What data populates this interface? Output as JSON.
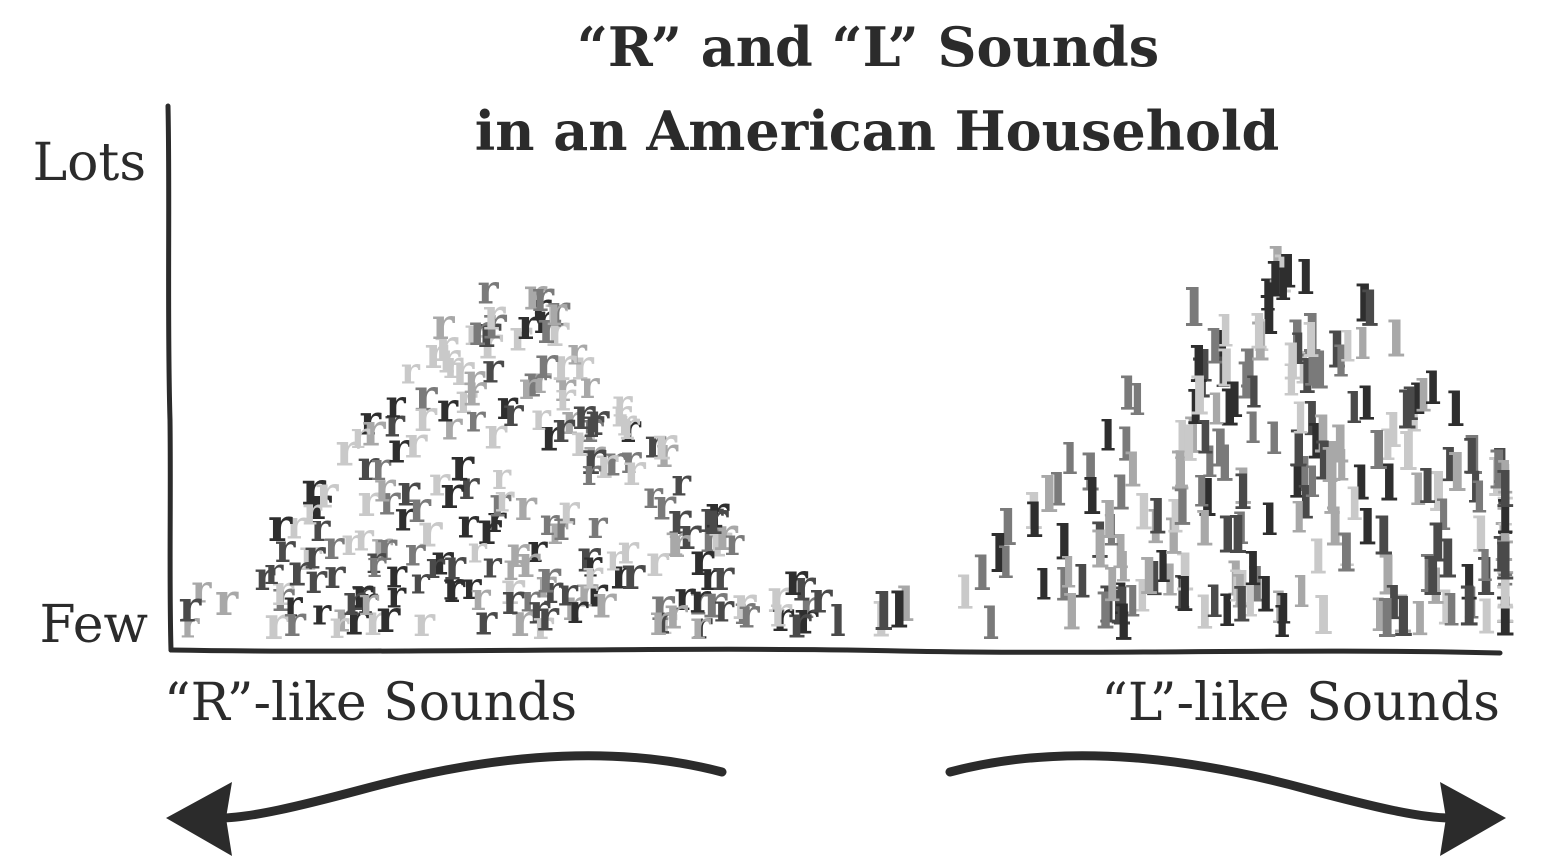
{
  "chart_data": {
    "type": "area",
    "title_line1": "“R” and “L” Sounds",
    "title_line2": "in an American Household",
    "y_top_label": "Lots",
    "y_bottom_label": "Few",
    "categories": [
      "“R”-like Sounds",
      "“L”-like Sounds"
    ],
    "series": [
      {
        "glyph": "r",
        "peak_x": 0.24,
        "spread": 0.11,
        "peak_y": 0.93,
        "count": 230
      },
      {
        "glyph": "l",
        "peak_x": 0.83,
        "spread": 0.13,
        "peak_y": 0.98,
        "count": 230
      }
    ],
    "x_range": [
      0,
      1
    ],
    "y_range": [
      0,
      1
    ],
    "grid": false,
    "glyph_colors": [
      "#2e2e2e",
      "#4a4a4a",
      "#7a7a7a",
      "#a8a8a8",
      "#c9c9c9"
    ]
  }
}
